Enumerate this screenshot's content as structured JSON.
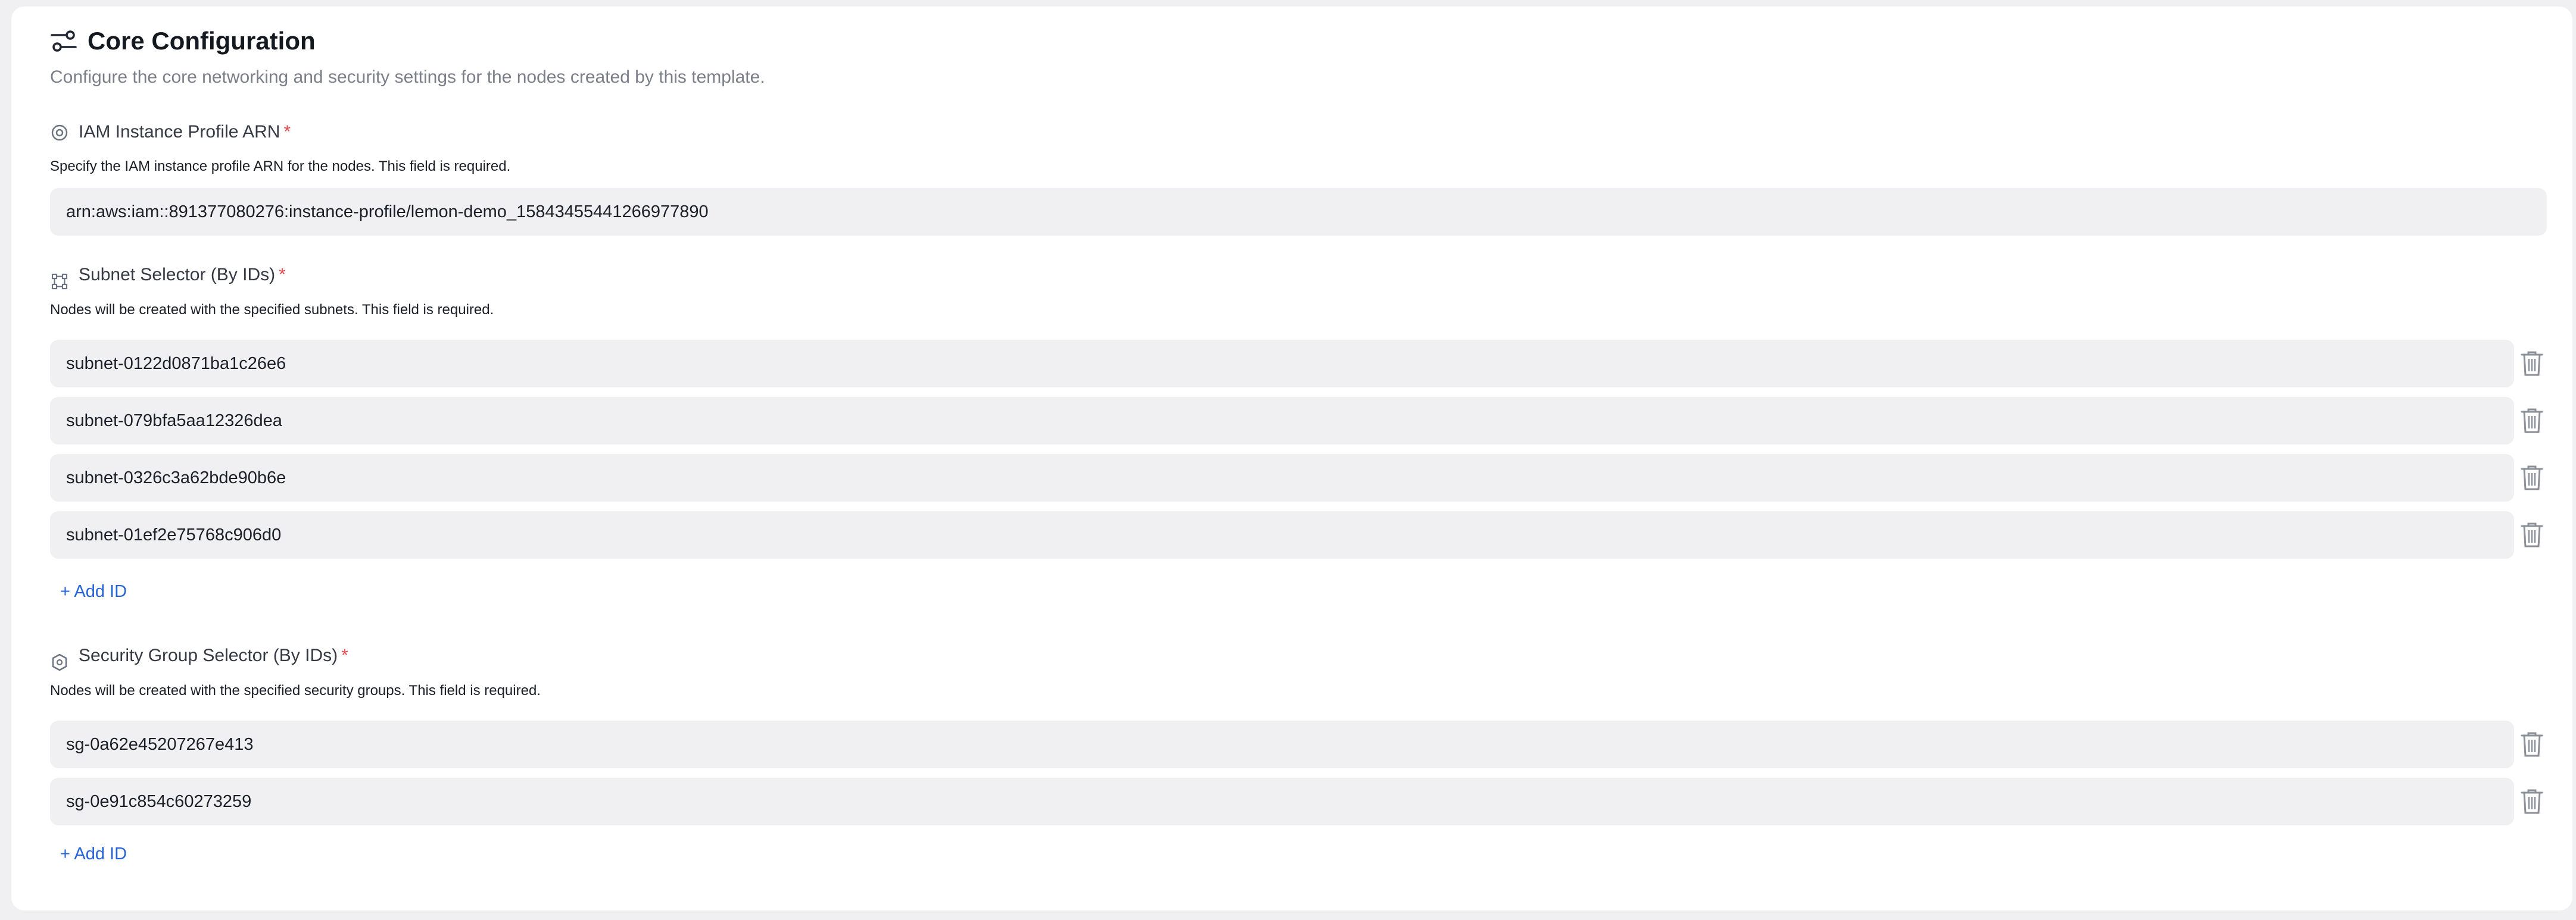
{
  "header": {
    "title": "Core Configuration",
    "subtitle": "Configure the core networking and security settings for the nodes created by this template.",
    "icon": "sliders-icon"
  },
  "iam": {
    "label": "IAM Instance Profile ARN",
    "required_mark": "*",
    "help": "Specify the IAM instance profile ARN for the nodes. This field is required.",
    "value": "arn:aws:iam::891377080276:instance-profile/lemon-demo_15843455441266977890",
    "icon": "target-icon"
  },
  "subnets": {
    "label": "Subnet Selector (By IDs)",
    "required_mark": "*",
    "help": "Nodes will be created with the specified subnets. This field is required.",
    "items": [
      "subnet-0122d0871ba1c26e6",
      "subnet-079bfa5aa12326dea",
      "subnet-0326c3a62bde90b6e",
      "subnet-01ef2e75768c906d0"
    ],
    "add_label": "+ Add ID",
    "icon": "network-icon"
  },
  "security_groups": {
    "label": "Security Group Selector (By IDs)",
    "required_mark": "*",
    "help": "Nodes will be created with the specified security groups. This field is required.",
    "items": [
      "sg-0a62e45207267e413",
      "sg-0e91c854c60273259"
    ],
    "add_label": "+ Add ID",
    "icon": "shield-icon"
  },
  "colors": {
    "accent": "#2563d9",
    "required": "#e5484d",
    "field_bg": "#f0f0f2",
    "muted_text": "#7b7f89"
  }
}
